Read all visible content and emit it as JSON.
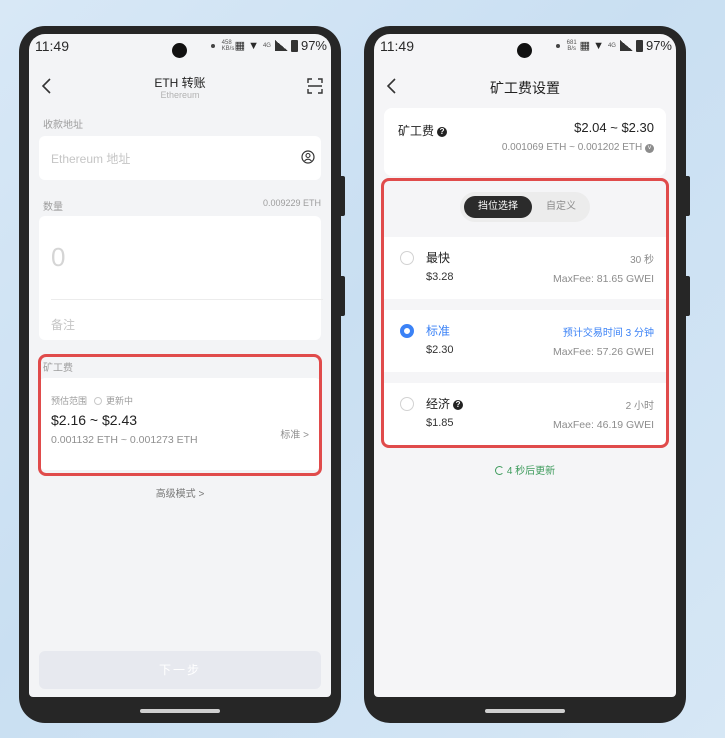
{
  "status_left": {
    "time": "11:49",
    "speed": "458 KB/s",
    "net": "4G",
    "battery": "97%"
  },
  "status_right": {
    "time": "11:49",
    "speed": "681 B/s",
    "net": "4G",
    "battery": "97%"
  },
  "transfer": {
    "title": "ETH 转账",
    "subtitle": "Ethereum",
    "address_label": "收款地址",
    "address_placeholder": "Ethereum 地址",
    "amount_label": "数量",
    "balance": "0.009229 ETH",
    "amount_value": "0",
    "memo_placeholder": "备注",
    "fee_label": "矿工费",
    "fee_range_label": "预估范围",
    "fee_updating": "更新中",
    "fee_usd": "$2.16 ~ $2.43",
    "fee_eth": "0.001132 ETH ~ 0.001273 ETH",
    "fee_level": "标准 >",
    "advanced": "高级模式 >",
    "next_button": "下一步"
  },
  "fee_settings": {
    "title": "矿工费设置",
    "fee_label": "矿工费",
    "fee_usd": "$2.04 ~ $2.30",
    "fee_eth": "0.001069 ETH ~ 0.001202 ETH",
    "tab_tier": "挡位选择",
    "tab_custom": "自定义",
    "options": [
      {
        "name": "最快",
        "price": "$3.28",
        "eta": "30 秒",
        "maxfee": "MaxFee: 81.65 GWEI",
        "selected": false
      },
      {
        "name": "标准",
        "price": "$2.30",
        "eta": "预计交易时间 3 分钟",
        "maxfee": "MaxFee: 57.26 GWEI",
        "selected": true
      },
      {
        "name": "经济",
        "price": "$1.85",
        "eta": "2 小时",
        "maxfee": "MaxFee: 46.19 GWEI",
        "selected": false
      }
    ],
    "refresh_text": "4 秒后更新"
  },
  "colors": {
    "accent": "#3b82f6",
    "highlight": "#e04b4b",
    "refresh": "#3e9b5c"
  }
}
